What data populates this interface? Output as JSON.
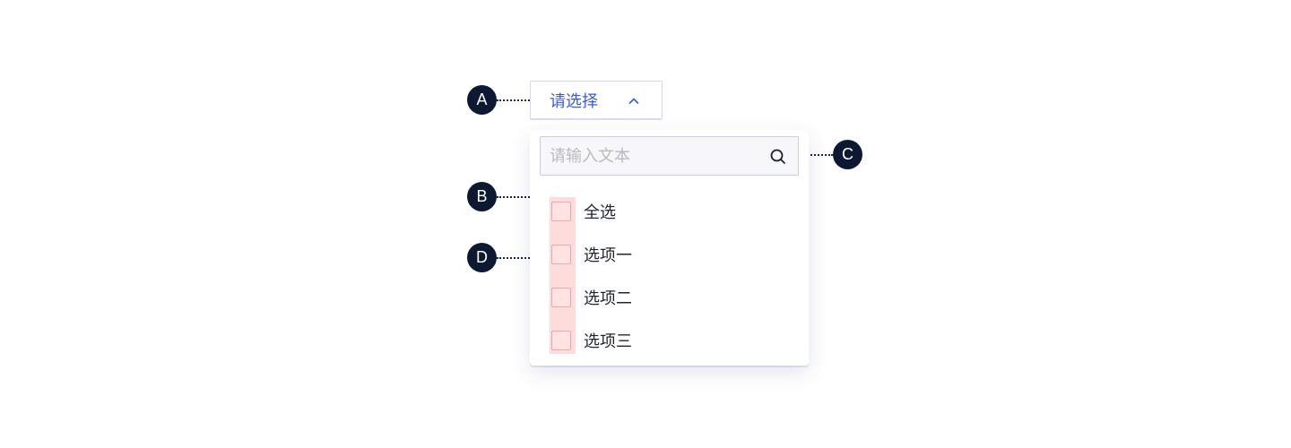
{
  "select": {
    "placeholder_label": "请选择",
    "accent_color": "#3b5bdb",
    "expanded": true
  },
  "dropdown": {
    "search": {
      "placeholder": "请输入文本",
      "value": ""
    },
    "options": [
      {
        "label": "全选",
        "checked": false
      },
      {
        "label": "选项一",
        "checked": false
      },
      {
        "label": "选项二",
        "checked": false
      },
      {
        "label": "选项三",
        "checked": false
      }
    ]
  },
  "annotations": {
    "a": "A",
    "b": "B",
    "c": "C",
    "d": "D",
    "badge_color": "#0d1833",
    "highlight_color": "#ffdcdc"
  }
}
